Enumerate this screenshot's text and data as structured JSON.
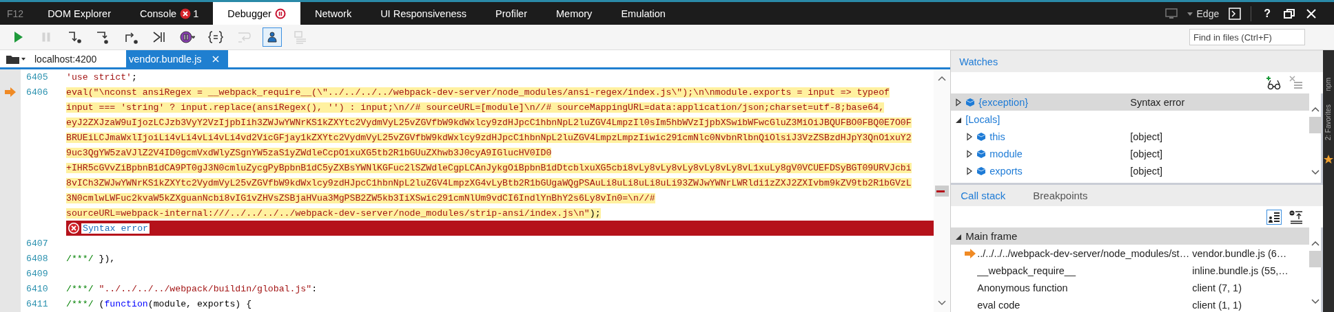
{
  "brand": "F12",
  "devtools_tabs": [
    {
      "label": "DOM Explorer",
      "kind": "tab",
      "selected": false
    },
    {
      "label": "Console",
      "kind": "errors",
      "selected": false,
      "error_count": "1"
    },
    {
      "label": "Debugger",
      "kind": "paused",
      "selected": true
    },
    {
      "label": "Network",
      "kind": "tab",
      "selected": false
    },
    {
      "label": "UI Responsiveness",
      "kind": "tab",
      "selected": false
    },
    {
      "label": "Profiler",
      "kind": "tab",
      "selected": false
    },
    {
      "label": "Memory",
      "kind": "tab",
      "selected": false
    },
    {
      "label": "Emulation",
      "kind": "tab",
      "selected": false
    }
  ],
  "window_controls": {
    "browser": "Edge",
    "help": "?"
  },
  "toolbar": {
    "buttons": [
      {
        "kind": "continue",
        "disabled": false,
        "selected": false
      },
      {
        "kind": "pause",
        "disabled": true,
        "selected": false
      },
      {
        "kind": "step-into",
        "disabled": false,
        "selected": false
      },
      {
        "kind": "step-over",
        "disabled": false,
        "selected": false
      },
      {
        "kind": "step-out",
        "disabled": false,
        "selected": false
      },
      {
        "kind": "break-worker",
        "disabled": false,
        "selected": false
      },
      {
        "kind": "exceptions",
        "disabled": false,
        "selected": false
      },
      {
        "kind": "pretty-print",
        "disabled": false,
        "selected": false
      },
      {
        "kind": "word-wrap",
        "disabled": true,
        "selected": false
      },
      {
        "kind": "just-my-code",
        "disabled": false,
        "selected": true
      },
      {
        "kind": "source-map",
        "disabled": true,
        "selected": false
      }
    ],
    "search": {
      "placeholder": "Find in files (Ctrl+F)"
    }
  },
  "file_tabs": {
    "location": "localhost:4200",
    "tabs": [
      {
        "label": "vendor.bundle.js",
        "selected": true
      }
    ]
  },
  "code": {
    "lines": [
      {
        "kind": "code",
        "number": "6405",
        "rows": [
          [
            {
              "kind": "string",
              "s": "'use strict'"
            },
            {
              "kind": "plain",
              "s": ";"
            }
          ]
        ]
      },
      {
        "kind": "code",
        "number": "6406",
        "current": true,
        "highlighted": true,
        "rows": [
          [
            {
              "kind": "string",
              "s": "eval(\"\\nconst ansiRegex = __webpack_require__(\\\"../../../../webpack-dev-server/node_modules/ansi-regex/index.js\\\");\\n\\nmodule.exports = input => typeof"
            }
          ],
          [
            {
              "kind": "string",
              "s": "input === 'string' ? input.replace(ansiRegex(), '') : input;\\n//# sourceURL=[module]\\n//# sourceMappingURL=data:application/json;charset=utf-8;base64,"
            }
          ],
          [
            {
              "kind": "string",
              "s": "eyJ2ZXJzaW9uIjozLCJzb3VyY2VzIjpbIih3ZWJwYWNrKS1kZXYtc2VydmVyL25vZGVfbW9kdWxlcy9zdHJpcC1hbnNpL2luZGV4LmpzIl0sIm5hbWVzIjpbXSwibWFwcGluZ3MiOiJBQUFBO0FBQ0E7O0F"
            }
          ],
          [
            {
              "kind": "string",
              "s": "BRUEiLCJmaWxlIjoiLi4vLi4vLi4vLi4vd2VicGFjay1kZXYtc2VydmVyL25vZGVfbW9kdWxlcy9zdHJpcC1hbnNpL2luZGV4LmpzLmpzIiwic291cmNlc0NvbnRlbnQiOlsiJ3VzZSBzdHJpY3QnO1xuY2"
            }
          ],
          [
            {
              "kind": "string",
              "s": "9uc3QgYW5zaVJlZ2V4ID0gcmVxdWlyZSgnYW5zaS1yZWdleCcpO1xuXG5tb2R1bGUuZXhwb3J0cyA9IGlucHV0ID0"
            }
          ],
          [
            {
              "kind": "string",
              "s": "+IHR5cGVvZiBpbnB1dCA9PT0gJ3N0cmluZycgPyBpbnB1dC5yZXBsYWNlKGFuc2lSZWdleCgpLCAnJykgOiBpbnB1dDtcblxuXG5cbi8vLy8vLy8vLy8vLy8vLy8vL1xuLy8gV0VCUEFDSyBGT09URVJcbi"
            }
          ],
          [
            {
              "kind": "string",
              "s": "8vICh3ZWJwYWNrKS1kZXYtc2VydmVyL25vZGVfbW9kdWxlcy9zdHJpcC1hbnNpL2luZGV4LmpzXG4vLyBtb2R1bGUgaWQgPSAuLi8uLi8uLi8uLi93ZWJwYWNrLWRldi1zZXJ2ZXIvbm9kZV9tb2R1bGVzL"
            }
          ],
          [
            {
              "kind": "string",
              "s": "3N0cmlwLWFuc2kvaW5kZXguanNcbi8vIG1vZHVsZSBjaHVua3MgPSB2ZW5kb3IiXSwic291cmNlUm9vdCI6IndlYnBhY2s6Ly8vIn0=\\n//#"
            }
          ],
          [
            {
              "kind": "string",
              "s": "sourceURL=webpack-internal:///../../../../webpack-dev-server/node_modules/strip-ansi/index.js\\n\""
            },
            {
              "kind": "plain",
              "s": ");"
            }
          ]
        ]
      },
      {
        "kind": "error",
        "message": "Syntax error"
      },
      {
        "kind": "code",
        "number": "6407"
      },
      {
        "kind": "code",
        "number": "6408",
        "rows": [
          [
            {
              "kind": "comment",
              "s": "/***/"
            },
            {
              "kind": "plain",
              "s": " }),"
            }
          ]
        ]
      },
      {
        "kind": "code",
        "number": "6409"
      },
      {
        "kind": "code",
        "number": "6410",
        "rows": [
          [
            {
              "kind": "comment",
              "s": "/***/"
            },
            {
              "kind": "string",
              "s": " \"../../../../webpack/buildin/global.js\""
            },
            {
              "kind": "plain",
              "s": ":"
            }
          ]
        ]
      },
      {
        "kind": "code",
        "number": "6411",
        "rows": [
          [
            {
              "kind": "comment",
              "s": "/***/"
            },
            {
              "kind": "plain",
              "s": " ("
            },
            {
              "kind": "keyword",
              "s": "function"
            },
            {
              "kind": "plain",
              "s": "(module, exports) {"
            }
          ]
        ]
      }
    ]
  },
  "watches": {
    "title": "Watches",
    "items": [
      {
        "kind": "object",
        "name": "{exception}",
        "value": "Syntax error",
        "expanded": false,
        "selected": true
      },
      {
        "kind": "scope",
        "name": "[Locals]",
        "expanded": true,
        "selected": false,
        "children": [
          {
            "kind": "object",
            "name": "this",
            "value": "[object]",
            "expanded": false,
            "selected": false
          },
          {
            "kind": "object",
            "name": "module",
            "value": "[object]",
            "expanded": false,
            "selected": false
          },
          {
            "kind": "object",
            "name": "exports",
            "value": "[object]",
            "expanded": false,
            "selected": false
          }
        ]
      }
    ]
  },
  "call_stack": {
    "tabs": [
      {
        "label": "Call stack",
        "selected": true
      },
      {
        "label": "Breakpoints",
        "selected": false
      }
    ],
    "group": {
      "label": "Main frame",
      "expanded": true,
      "frames": [
        {
          "function": "../../../../webpack-dev-server/node_modules/st…",
          "location": "vendor.bundle.js (6…",
          "current": true
        },
        {
          "function": "__webpack_require__",
          "location": "inline.bundle.js (55,…",
          "current": false
        },
        {
          "function": "Anonymous function",
          "location": "client (7, 1)",
          "current": false
        },
        {
          "function": "eval code",
          "location": "client (1, 1)",
          "current": false
        }
      ]
    }
  },
  "side_strip": {
    "labels": [
      "npm",
      "2: Favorites"
    ]
  }
}
